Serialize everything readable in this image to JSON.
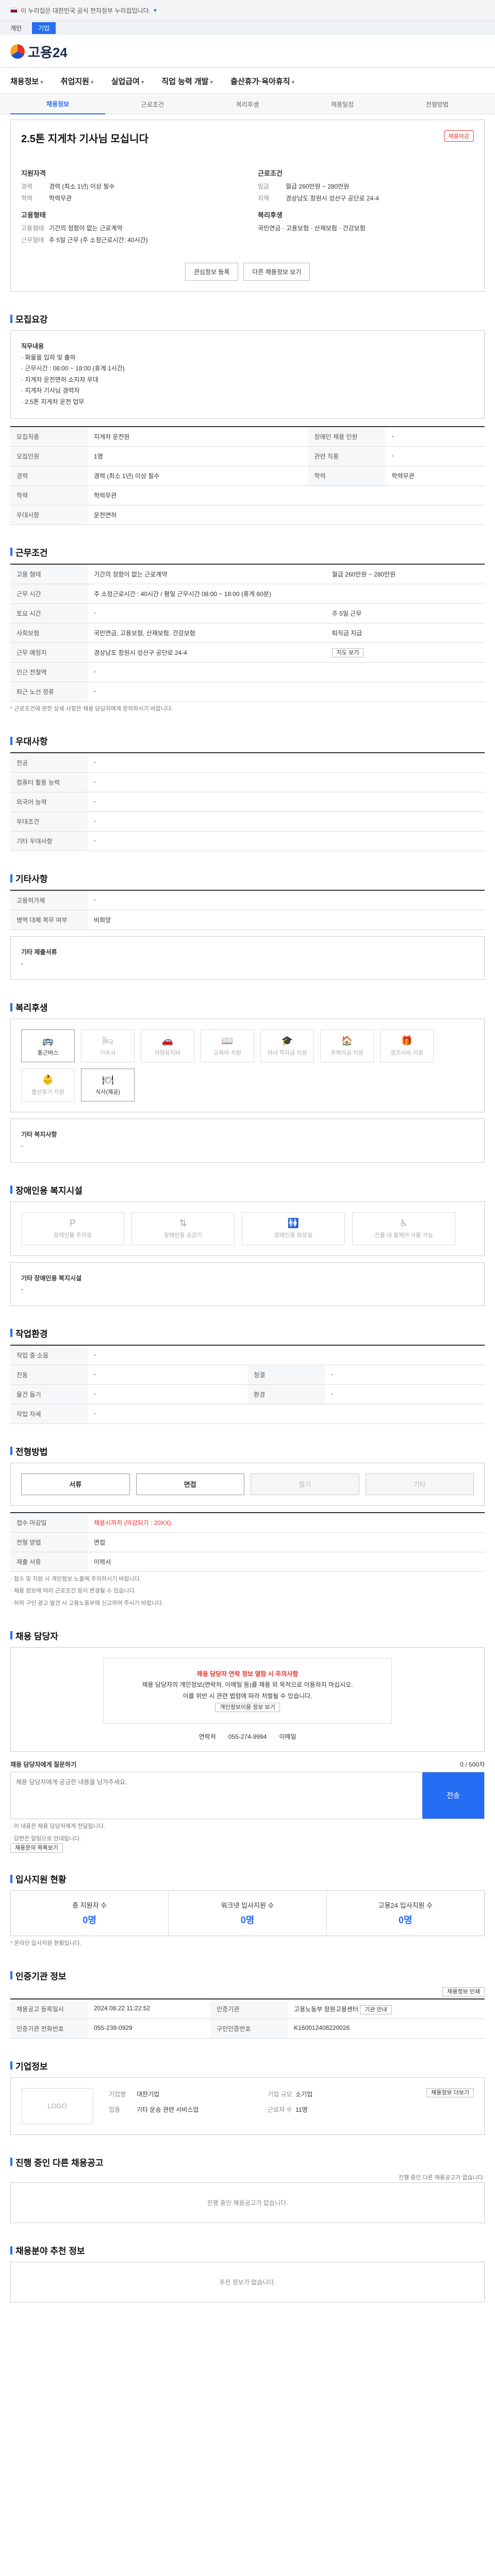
{
  "gov": {
    "notice": "이 누리집은 대한민국 공식 전자정부 누리집입니다.",
    "toggle": "▾"
  },
  "util": {
    "items": [
      "개인",
      "기업"
    ]
  },
  "header": {
    "logo": "고용24"
  },
  "gnb": {
    "items": [
      "채용정보",
      "취업지원",
      "실업급여",
      "직업 능력 개발",
      "출산휴가·육아휴직"
    ]
  },
  "subnav": {
    "items": [
      "채용정보",
      "근로조건",
      "복리후생",
      "채용일정",
      "전형방법"
    ]
  },
  "job": {
    "title": "2.5톤 지게차 기사님 모십니다",
    "badge": "채용마감",
    "recruit": {
      "heading": "지원자격",
      "rows": [
        {
          "k": "경력",
          "v": "경력 (최소 1년) 이상 필수"
        },
        {
          "k": "학력",
          "v": "학력무관"
        }
      ]
    },
    "work": {
      "heading": "근로조건",
      "rows": [
        {
          "k": "임금",
          "v": "월급 260만원 ~ 280만원"
        },
        {
          "k": "지역",
          "v": "경상남도 창원시 성산구 공단로 24-4"
        }
      ]
    },
    "jobtype": {
      "heading": "고용형태",
      "rows": [
        {
          "k": "고용형태",
          "v": "기간의 정함이 없는 근로계약"
        },
        {
          "k": "근무형태",
          "v": "주 5일 근무 (주 소정근로시간: 40시간)"
        }
      ]
    },
    "welfare": {
      "heading": "복리후생",
      "rows": [
        {
          "k": "",
          "v": "국민연금 · 고용보험 · 산재보험 · 건강보험"
        }
      ]
    },
    "apply_btn": "관심정보 등록",
    "share_btn": "다른 채용정보 보기"
  },
  "s1": {
    "title": "모집요강",
    "box_title": "직무내용",
    "lines": [
      "· 화물을 입하 및 출하",
      "· 근무시간 : 08:00 ~ 18:00 (휴게 1시간)",
      "· 지게차 운전면허 소지자 우대",
      "· 지게차 기사님 경력자",
      "· 2.5톤 지게차 운전 업무"
    ],
    "rows": [
      {
        "k": "모집직종",
        "v": "지게차 운전원"
      },
      {
        "k": "모집인원",
        "v": "1명"
      },
      {
        "k": "경력",
        "v": "경력 (최소 1년) 이상 필수"
      },
      {
        "k": "학력",
        "v": "학력무관"
      },
      {
        "k": "우대사항",
        "v": "운전면허"
      }
    ],
    "rows2": [
      {
        "k": "장애인 채용 인원",
        "v": "-"
      },
      {
        "k": "관련 직종",
        "v": "-"
      },
      {
        "k": "학력",
        "v": "학력무관"
      }
    ]
  },
  "s2": {
    "title": "근무조건",
    "rows": [
      {
        "k": "고용 형태",
        "v": "기간의 정함이 없는 근로계약"
      },
      {
        "k": "근무 시간",
        "v": "주 소정근로시간 : 40시간 / 평일 근무시간 08:00 ~ 18:00 (휴게 60분)"
      },
      {
        "k": "토요 시간",
        "v": "-"
      },
      {
        "k": "사회보험",
        "v": "국민연금, 고용보험, 산재보험, 건강보험"
      },
      {
        "k": "근무 예정지",
        "v": "경상남도 창원시 성산구 공단로 24-4"
      },
      {
        "k": "인근 전철역",
        "v": "-"
      },
      {
        "k": "퇴근 노선 정류",
        "v": "-"
      }
    ],
    "pay": "월급 260만원 ~ 280만원",
    "hours": "주 5일 근무",
    "retire": "퇴직금 지급",
    "map_btn": "지도 보기",
    "note": "* 근로조건에 관한 상세 사항은 채용 담당자에게 문의하시기 바랍니다."
  },
  "s3": {
    "title": "우대사항",
    "rows": [
      {
        "k": "전공",
        "v": "-"
      },
      {
        "k": "컴퓨터 활용 능력",
        "v": "-"
      },
      {
        "k": "외국어 능력",
        "v": "-"
      },
      {
        "k": "우대조건",
        "v": "-"
      },
      {
        "k": "기타 우대사항",
        "v": "-"
      }
    ]
  },
  "s4": {
    "title": "기타사항",
    "rows": [
      {
        "k": "고용허가제",
        "v": "-"
      },
      {
        "k": "병역 대체 복무 여부",
        "v": "비희망"
      }
    ],
    "sub": "기타 제출서류",
    "none": "-"
  },
  "s5": {
    "title": "복리후생",
    "cards": [
      "통근버스",
      "기숙사",
      "차량유지비",
      "교육비 지원",
      "자녀 학자금 지원",
      "주택자금 지원",
      "경조사비 지원",
      "출산휴가 지원",
      "식사(제공)"
    ],
    "other": "기타 복지사항",
    "other_v": "-"
  },
  "s6": {
    "title": "장애인용 복지시설",
    "cards": [
      "장애인용 주차장",
      "장애인용 승강기",
      "장애인용 화장실",
      "건물 내 휠체어 사용 가능"
    ],
    "other": "기타 장애인용 복지시설",
    "other_v": "-"
  },
  "s7": {
    "title": "작업환경",
    "rows": [
      {
        "k": "작업 중 소음",
        "v": "-"
      },
      {
        "k": "진동",
        "v": "-"
      },
      {
        "k": "청결",
        "v": "-"
      },
      {
        "k": "물건 들기",
        "v": "-"
      },
      {
        "k": "환경",
        "v": "-"
      },
      {
        "k": "작업 자세",
        "v": "-"
      }
    ]
  },
  "s8": {
    "title": "전형방법",
    "steps": [
      "서류",
      "면접",
      "필기",
      "기타"
    ],
    "rows": [
      {
        "k": "접수 마감일",
        "v": "채용시까지 (마감되기 : 20XX)"
      },
      {
        "k": "전형 방법",
        "v": "면접"
      },
      {
        "k": "제출 서류",
        "v": "이력서"
      }
    ],
    "notes": [
      "· 접수 및 지원 시 개인정보 노출에 주의하시기 바랍니다.",
      "· 채용 정보에 따라 근로조건 등이 변경될 수 있습니다.",
      "· 허위 구인 광고 발견 시 고용노동부에 신고하여 주시기 바랍니다."
    ]
  },
  "s9": {
    "title": "채용 담당자",
    "warn1": "채용 담당자 연락 정보 열람 시 주의사항",
    "warn2": "채용 담당자의 개인정보(연락처, 이메일 등)를 채용 외 목적으로 이용하지 마십시오.",
    "warn3": "이를 위반 시 관련 법령에 따라 처벌될 수 있습니다.",
    "info_btn": "개인정보이용 정보 보기",
    "tel_k": "연락처",
    "tel_v": "055-274-9994",
    "email_k": "이메일",
    "inq_title": "채용 담당자에게 질문하기",
    "inq_count": "0 / 500자",
    "inq_ph": "채용 담당자에게 궁금한 내용을 남겨주세요.",
    "inq_send": "전송",
    "inq_notes": [
      "· 이 내용은 채용 담당자에게 전달됩니다.",
      "· 답변은 알림으로 안내됩니다."
    ],
    "inq_btn": "채용문의 목록보기"
  },
  "s10": {
    "title": "입사지원 현황",
    "stats": [
      {
        "label": "총 지원자 수",
        "v": "0명"
      },
      {
        "label": "워크넷 입사지원 수",
        "v": "0명"
      },
      {
        "label": "고용24 입사지원 수",
        "v": "0명"
      }
    ],
    "note": "* 온라인 입사지원 현황입니다."
  },
  "s11": {
    "title": "인증기관 정보",
    "print_btn": "채용정보 인쇄",
    "rows": [
      {
        "k": "채용공고 등록일시",
        "v": "2024.08.22 11:22:52"
      },
      {
        "k": "인증기관",
        "v": "고용노동부 창원고용센터"
      },
      {
        "k": "인증기관 전화번호",
        "v": "055-239-0929"
      },
      {
        "k": "구인인증번호",
        "v": "K160012408220026"
      }
    ],
    "link": "기관 안내"
  },
  "s12": {
    "title": "기업정보",
    "logo": "LOGO",
    "name_k": "기업명",
    "name_v": "대한기업",
    "ind_k": "업종",
    "ind_v": "기타 운송 관련 서비스업",
    "size_k": "기업 규모",
    "size_v": "소기업",
    "emp_k": "근로자 수",
    "emp_v": "11명",
    "btn": "채용정보 더보기"
  },
  "s13": {
    "title": "진행 중인 다른 채용공고",
    "sub": "진행 중인 다른 채용공고가 없습니다.",
    "empty": "진행 중인 채용공고가 없습니다."
  },
  "s14": {
    "title": "채용분야 추천 정보",
    "empty": "추천 정보가 없습니다."
  }
}
